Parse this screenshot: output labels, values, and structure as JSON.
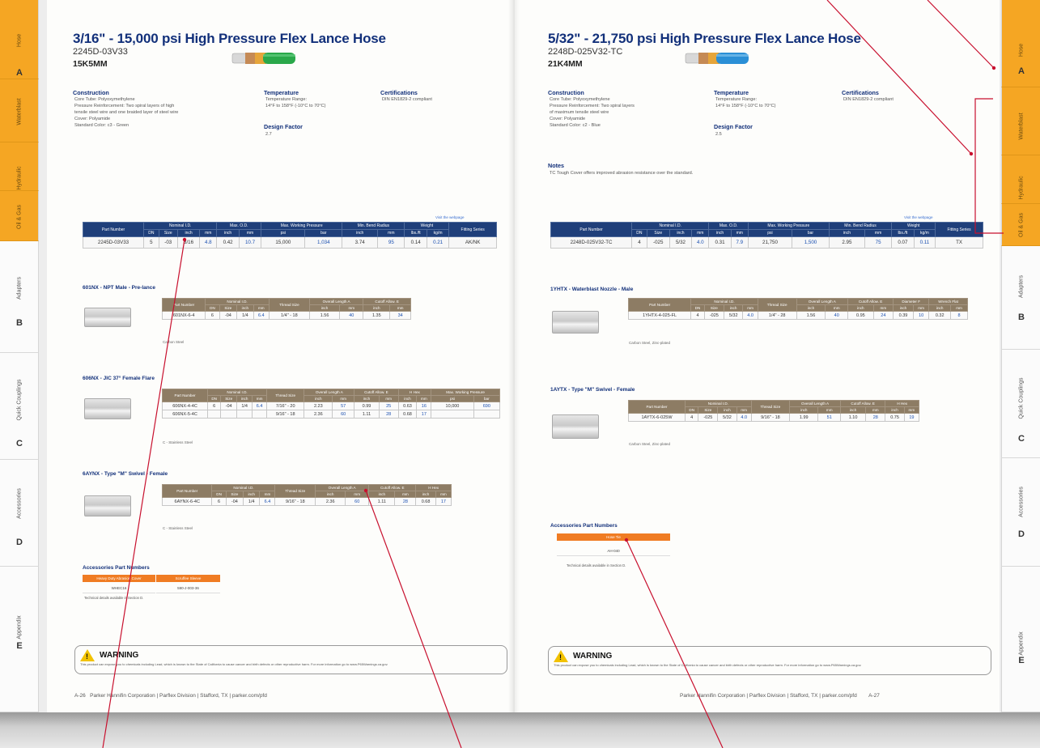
{
  "left_page": {
    "title": "3/16\" - 15,000 psi High Pressure Flex Lance Hose",
    "part_number": "2245D-03V33",
    "code": "15K5MM",
    "construction": {
      "heading": "Construction",
      "items": [
        "Core Tube: Polyoxymethylene",
        "Pressure Reinforcement: Two spiral layers of high",
        "tensile steel wire and one braided layer of steel wire",
        "Cover: Polyamide",
        "Standard Color: c3 - Green"
      ]
    },
    "temperature": {
      "heading": "Temperature",
      "items": [
        "Temperature Range:",
        "14°F to 158°F (-10°C to 70°C)"
      ]
    },
    "design_factor": {
      "heading": "Design Factor",
      "items": [
        "2.7"
      ]
    },
    "certifications": {
      "heading": "Certifications",
      "items": [
        "DIN EN1829-2 compliant"
      ]
    },
    "web_ref": "Visit the webpage",
    "spec_headers": [
      "Part Number",
      "Nominal I.D.",
      "Max. O.D.",
      "Max. Working Pressure",
      "Min. Bend Radius",
      "Weight",
      "Fitting Series"
    ],
    "spec_sub": [
      "",
      "DN",
      "Size",
      "inch",
      "mm",
      "inch",
      "mm",
      "psi",
      "bar",
      "inch",
      "mm",
      "lbs./ft",
      "kg/m",
      ""
    ],
    "spec_row": [
      "2245D-03V33",
      "5",
      "-03",
      "3/16",
      "4.8",
      "0.42",
      "10.7",
      "15,000",
      "1,034",
      "3.74",
      "95",
      "0.14",
      "0.21",
      "AK/NK"
    ],
    "fittings": [
      {
        "title": "601NX - NPT Male - Pre-lance",
        "headers": [
          "Part Number",
          "Nominal I.D.",
          "Thread Size",
          "Overall Length A",
          "Cutoff Allow. E"
        ],
        "sub": [
          "",
          "DN",
          "Size",
          "inch",
          "mm",
          "",
          "inch",
          "mm",
          "inch",
          "mm"
        ],
        "rows": [
          [
            "601NX-6-4",
            "6",
            "-04",
            "1/4",
            "6.4",
            "1/4\" - 18",
            "1.56",
            "40",
            "1.35",
            "34"
          ]
        ],
        "note": "Carbon Steel"
      },
      {
        "title": "606NX - JIC 37° Female Flare",
        "headers": [
          "Part Number",
          "Nominal I.D.",
          "Thread Size",
          "Overall Length A",
          "Cutoff Allow. E",
          "H Hex",
          "Max. Working Pressure"
        ],
        "sub": [
          "",
          "DN",
          "Size",
          "inch",
          "mm",
          "",
          "inch",
          "mm",
          "inch",
          "mm",
          "inch",
          "mm",
          "psi",
          "bar"
        ],
        "rows": [
          [
            "606NX-4-4C",
            "6",
            "-04",
            "1/4",
            "6.4",
            "7/16\" - 20",
            "2.23",
            "57",
            "0.99",
            "25",
            "0.63",
            "16",
            "10,000",
            "690"
          ],
          [
            "606NX-5-4C",
            "",
            "",
            "",
            "",
            "9/16\" - 18",
            "2.36",
            "60",
            "1.11",
            "28",
            "0.68",
            "17",
            "",
            ""
          ]
        ],
        "note": "C - Stainless Steel"
      },
      {
        "title": "6AYNX - Type \"M\" Swivel - Female",
        "headers": [
          "Part Number",
          "Nominal I.D.",
          "Thread Size",
          "Overall Length A",
          "Cutoff Allow. E",
          "H Hex"
        ],
        "sub": [
          "",
          "DN",
          "Size",
          "inch",
          "mm",
          "",
          "inch",
          "mm",
          "inch",
          "mm",
          "inch",
          "mm"
        ],
        "rows": [
          [
            "6AYNX-6-4C",
            "6",
            "-04",
            "1/4",
            "6.4",
            "9/16\" - 18",
            "2.36",
            "60",
            "1.11",
            "28",
            "0.68",
            "17"
          ]
        ],
        "note": "C - Stainless Steel"
      }
    ],
    "accessories": {
      "heading": "Accessories Part Numbers",
      "headers": [
        "Heavy Duty Abrasion Cover",
        "Scruffee Sleeve"
      ],
      "values": [
        "WHEC16",
        "590-J-003-36"
      ],
      "note": "Technical details available in Section D."
    },
    "warning": {
      "title": "WARNING",
      "text": "This product can expose you to chemicals including Lead, which is known to the State of California to cause cancer and birth defects or other reproductive harm. For more information go to www.P65Warnings.ca.gov."
    },
    "footer": {
      "page": "A-26",
      "text": "Parker Hannifin Corporation | Parflex Division | Stafford, TX | parker.com/pfd"
    },
    "tabs": [
      {
        "label": "Hose",
        "letter": "A"
      },
      {
        "label": "Waterblast",
        "letter": ""
      },
      {
        "label": "Hydraulic",
        "letter": ""
      },
      {
        "label": "Oil & Gas",
        "letter": ""
      },
      {
        "label": "Adapters",
        "letter": "B"
      },
      {
        "label": "Quick Couplings",
        "letter": "C"
      },
      {
        "label": "Accessories",
        "letter": "D"
      },
      {
        "label": "Appendix",
        "letter": "E"
      }
    ]
  },
  "right_page": {
    "title": "5/32\" - 21,750 psi High Pressure Flex Lance Hose",
    "part_number": "2248D-025V32-TC",
    "code": "21K4MM",
    "construction": {
      "heading": "Construction",
      "items": [
        "Core Tube: Polyoxymethylene",
        "Pressure Reinforcement: Two spiral layers",
        "of maximum tensile steel wire",
        "Cover: Polyamide",
        "Standard Color: c2 - Blue"
      ]
    },
    "temperature": {
      "heading": "Temperature",
      "items": [
        "Temperature Range:",
        "14°F to 158°F (-10°C to 70°C)"
      ]
    },
    "design_factor": {
      "heading": "Design Factor",
      "items": [
        "2.5"
      ]
    },
    "certifications": {
      "heading": "Certifications",
      "items": [
        "DIN EN1829-2 compliant"
      ]
    },
    "notes": {
      "heading": "Notes",
      "items": [
        "TC Tough Cover offers improved abrasion resistance over the standard."
      ]
    },
    "web_ref": "Visit the webpage",
    "spec_headers": [
      "Part Number",
      "Nominal I.D.",
      "Max. O.D.",
      "Max. Working Pressure",
      "Min. Bend Radius",
      "Weight",
      "Fitting Series"
    ],
    "spec_sub": [
      "",
      "DN",
      "Size",
      "inch",
      "mm",
      "inch",
      "mm",
      "psi",
      "bar",
      "inch",
      "mm",
      "lbs./ft",
      "kg/m",
      ""
    ],
    "spec_row": [
      "2248D-025V32-TC",
      "4",
      "-025",
      "5/32",
      "4.0",
      "0.31",
      "7.9",
      "21,750",
      "1,500",
      "2.95",
      "75",
      "0.07",
      "0.11",
      "TX"
    ],
    "fittings": [
      {
        "title": "1YHTX - Waterblast Nozzle - Male",
        "headers": [
          "Part Number",
          "Nominal I.D.",
          "Thread Size",
          "Overall Length A",
          "Cutoff Allow. E",
          "Diameter F",
          "Wrench Flat"
        ],
        "sub": [
          "",
          "DN",
          "Size",
          "inch",
          "mm",
          "",
          "inch",
          "mm",
          "inch",
          "mm",
          "inch",
          "mm",
          "inch",
          "mm"
        ],
        "rows": [
          [
            "1YHTX-4-025-FL",
            "4",
            "-025",
            "5/32",
            "4.0",
            "1/4\" - 28",
            "1.56",
            "40",
            "0.95",
            "24",
            "0.39",
            "10",
            "0.32",
            "8"
          ]
        ],
        "note": "Carbon Steel, Zinc-plated"
      },
      {
        "title": "1AYTX - Type \"M\" Swivel - Female",
        "headers": [
          "Part Number",
          "Nominal I.D.",
          "Thread Size",
          "Overall Length A",
          "Cutoff Allow. E",
          "H Hex"
        ],
        "sub": [
          "",
          "DN",
          "Size",
          "inch",
          "mm",
          "",
          "inch",
          "mm",
          "inch",
          "mm",
          "inch",
          "mm"
        ],
        "rows": [
          [
            "1AYTX-6-025W",
            "4",
            "-025",
            "5/32",
            "4.0",
            "9/16\" - 18",
            "1.99",
            "51",
            "1.10",
            "28",
            "0.75",
            "19"
          ]
        ],
        "note": "Carbon Steel, Zinc-plated"
      }
    ],
    "accessories": {
      "heading": "Accessories Part Numbers",
      "headers": [
        "Hose Tie"
      ],
      "values": [
        "AH-040"
      ],
      "note": "Technical details available in Section D."
    },
    "warning": {
      "title": "WARNING",
      "text": "This product can expose you to chemicals including Lead, which is known to the State of California to cause cancer and birth defects or other reproductive harm. For more information go to www.P65Warnings.ca.gov."
    },
    "footer": {
      "page": "A-27",
      "text": "Parker Hannifin Corporation | Parflex Division | Stafford, TX | parker.com/pfd"
    },
    "tabs": [
      {
        "label": "Hose",
        "letter": "A"
      },
      {
        "label": "Waterblast",
        "letter": ""
      },
      {
        "label": "Hydraulic",
        "letter": ""
      },
      {
        "label": "Oil & Gas",
        "letter": ""
      },
      {
        "label": "Adapters",
        "letter": "B"
      },
      {
        "label": "Quick Couplings",
        "letter": "C"
      },
      {
        "label": "Accessories",
        "letter": "D"
      },
      {
        "label": "Appendix",
        "letter": "E"
      }
    ]
  },
  "colors": {
    "tab_active": "#f5a623",
    "title_blue": "#12307a",
    "spec_header": "#1f3f7a",
    "fitting_header": "#8d7c64",
    "accessory_header": "#f07c23",
    "leader_line": "#c8102e",
    "hose_green": "#2aa84a",
    "hose_blue": "#2a8fd6"
  },
  "icons": [
    "warning-triangle-icon"
  ]
}
